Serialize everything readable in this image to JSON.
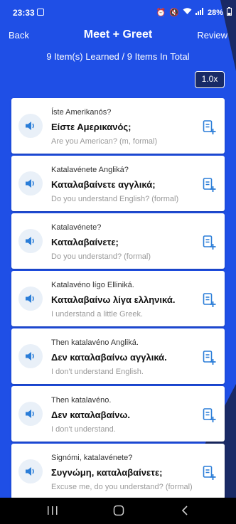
{
  "status": {
    "time": "23:33",
    "battery": "28%"
  },
  "header": {
    "back_label": "Back",
    "title": "Meet + Greet",
    "review_label": "Review"
  },
  "progress_text": "9 Item(s) Learned / 9 Items In Total",
  "speed_label": "1.0x",
  "colors": {
    "primary_blue": "#1f4fe6",
    "dark_blue": "#1a2a66",
    "accent_blue": "#2a7dd8"
  },
  "phrases": [
    {
      "translit": "Íste Amerikanós?",
      "greek": "Είστε Αμερικανός;",
      "english": "Are you American? (m, formal)"
    },
    {
      "translit": "Katalavénete Angliká?",
      "greek": "Καταλαβαίνετε αγγλικά;",
      "english": "Do you understand English? (formal)"
    },
    {
      "translit": "Katalavénete?",
      "greek": "Καταλαβαίνετε;",
      "english": "Do you understand? (formal)"
    },
    {
      "translit": "Katalavéno lígo Elliniká.",
      "greek": "Καταλαβαίνω λίγα ελληνικά.",
      "english": "I understand a little Greek."
    },
    {
      "translit": "Then katalavéno Angliká.",
      "greek": "Δεν καταλαβαίνω αγγλικά.",
      "english": "I don't understand English."
    },
    {
      "translit": "Then katalavéno.",
      "greek": "Δεν καταλαβαίνω.",
      "english": "I don't understand."
    },
    {
      "translit": "Signómi, katalavénete?",
      "greek": "Συγνώμη, καταλαβαίνετε;",
      "english": "Excuse me, do you understand? (formal)"
    }
  ],
  "icons": {
    "speaker": "speaker-icon",
    "add_note": "add-note-icon",
    "nav_recent": "recent-apps-icon",
    "nav_home": "home-icon",
    "nav_back": "back-icon"
  }
}
